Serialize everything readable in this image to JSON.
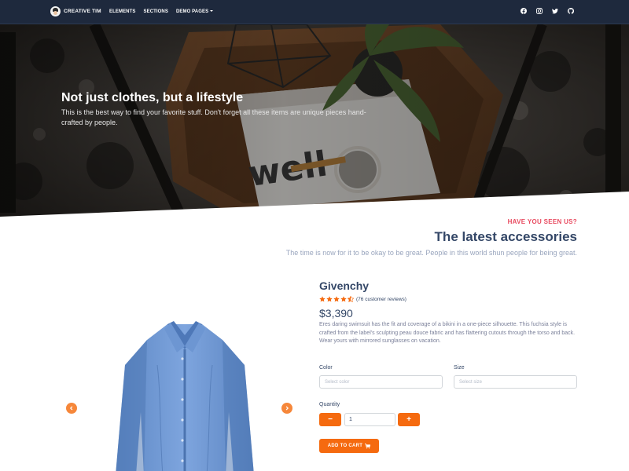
{
  "navbar": {
    "brand": "CREATIVE TIM",
    "links": [
      "ELEMENTS",
      "SECTIONS",
      "DEMO PAGES"
    ],
    "social_icons": [
      "facebook-icon",
      "instagram-icon",
      "twitter-icon",
      "github-icon"
    ]
  },
  "hero": {
    "title": "Not just clothes, but a lifestyle",
    "text": "This is the best way to find your favorite stuff. Don't forget all these items are unique pieces hand-crafted by people."
  },
  "section": {
    "eyebrow": "HAVE YOU SEEN US?",
    "title": "The latest accessories",
    "subtitle": "The time is now for it to be okay to be great. People in this world shun people for being great."
  },
  "product": {
    "name": "Givenchy",
    "rating": 4.5,
    "reviews": "(76 customer reviews)",
    "price": "$3,390",
    "description": "Eres daring swimsuit has the fit and coverage of a bikini in a one-piece silhouette. This fuchsia style is crafted from the label's sculpting peau douce fabric and has flattering cutouts through the torso and back. Wear yours with mirrored sunglasses on vacation.",
    "color_label": "Color",
    "color_placeholder": "Select color",
    "size_label": "Size",
    "size_placeholder": "Select size",
    "quantity_label": "Quantity",
    "quantity_value": "1",
    "minus": "−",
    "plus": "+",
    "add_to_cart": "ADD TO CART"
  },
  "colors": {
    "navbar": "#1e293d",
    "accent": "#f56a0f",
    "eyebrow": "#e84a5f",
    "heading": "#344767",
    "muted": "#7b809a"
  }
}
